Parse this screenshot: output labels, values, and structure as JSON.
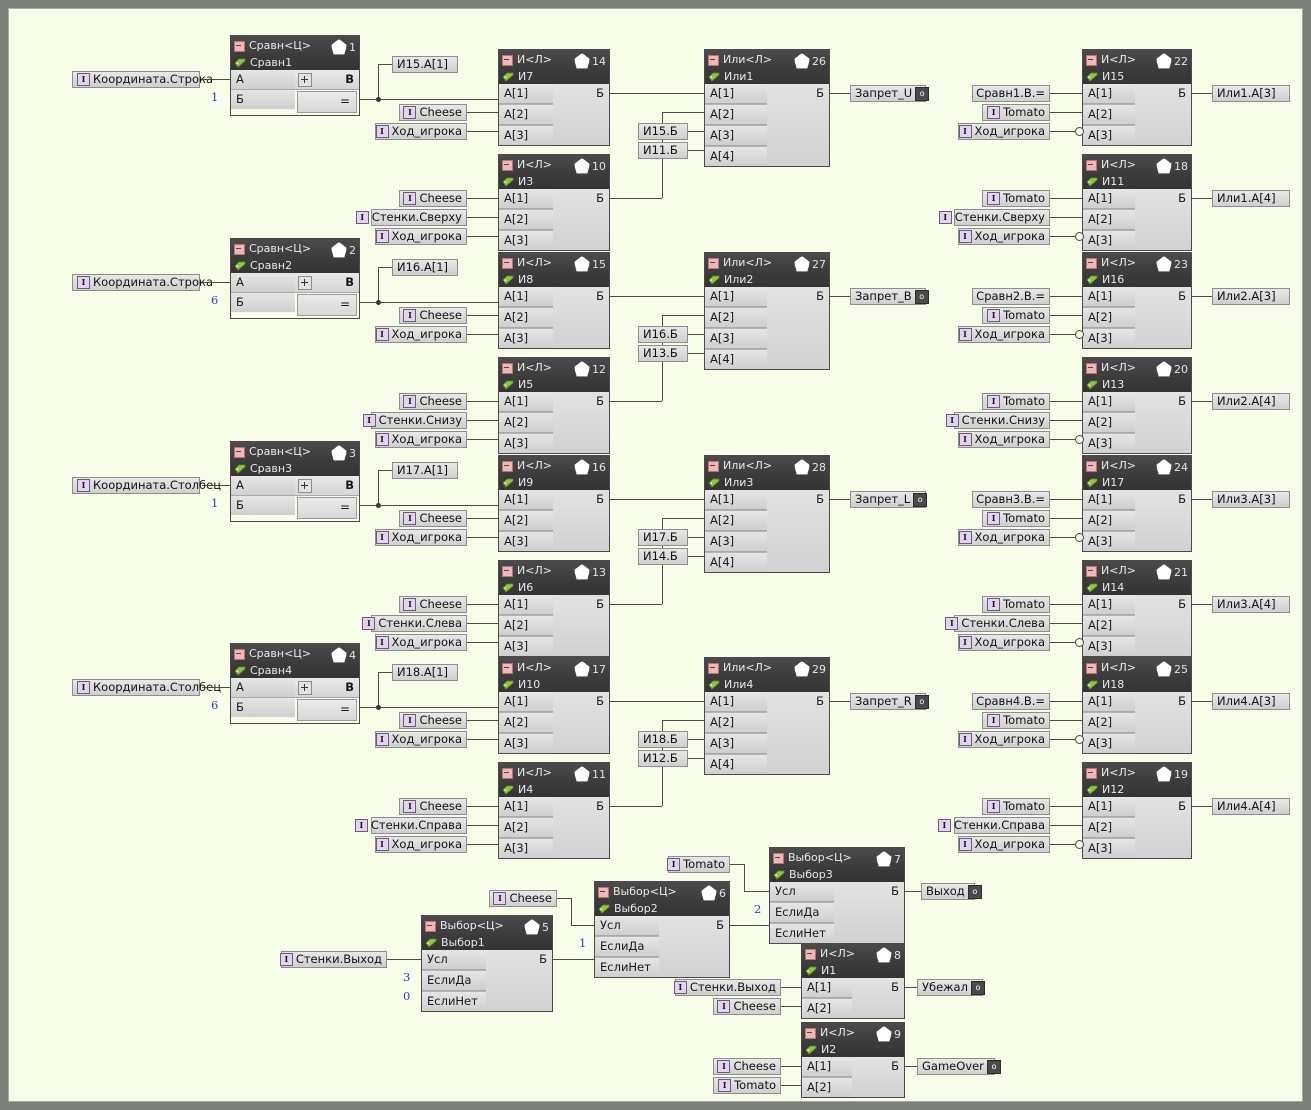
{
  "canvas": {
    "background": "#f8fde9",
    "frame_color": "#7d807a",
    "wire_color": "#4b4b4b"
  },
  "comparators": [
    {
      "id": "cmp1",
      "type": "Сравн<Ц>",
      "name": "Сравн1",
      "num": "1",
      "in_a": "А",
      "in_b": "Б",
      "out_top": "В",
      "op": "=",
      "const": "1",
      "source": "Координата.Строка"
    },
    {
      "id": "cmp2",
      "type": "Сравн<Ц>",
      "name": "Сравн2",
      "num": "2",
      "in_a": "А",
      "in_b": "Б",
      "out_top": "В",
      "op": "=",
      "const": "6",
      "source": "Координата.Строка"
    },
    {
      "id": "cmp3",
      "type": "Сравн<Ц>",
      "name": "Сравн3",
      "num": "3",
      "in_a": "А",
      "in_b": "Б",
      "out_top": "В",
      "op": "=",
      "const": "1",
      "source": "Координата.Столбец"
    },
    {
      "id": "cmp4",
      "type": "Сравн<Ц>",
      "name": "Сравн4",
      "num": "4",
      "in_a": "А",
      "in_b": "Б",
      "out_top": "В",
      "op": "=",
      "const": "6",
      "source": "Координата.Столбец"
    }
  ],
  "and_blocks": [
    {
      "id": "i7",
      "type": "И<Л>",
      "name": "И7",
      "num": "14",
      "pins": [
        "А[1]",
        "А[2]",
        "А[3]"
      ],
      "out": "Б",
      "inputs": [
        "",
        "Cheese",
        "Ход_игрока"
      ],
      "ref": "И15.А[1]"
    },
    {
      "id": "i3",
      "type": "И<Л>",
      "name": "И3",
      "num": "10",
      "pins": [
        "А[1]",
        "А[2]",
        "А[3]"
      ],
      "out": "Б",
      "inputs": [
        "Cheese",
        "Стенки.Сверху",
        "Ход_игрока"
      ]
    },
    {
      "id": "i8",
      "type": "И<Л>",
      "name": "И8",
      "num": "15",
      "pins": [
        "А[1]",
        "А[2]",
        "А[3]"
      ],
      "out": "Б",
      "inputs": [
        "",
        "Cheese",
        "Ход_игрока"
      ],
      "ref": "И16.А[1]"
    },
    {
      "id": "i5",
      "type": "И<Л>",
      "name": "И5",
      "num": "12",
      "pins": [
        "А[1]",
        "А[2]",
        "А[3]"
      ],
      "out": "Б",
      "inputs": [
        "Cheese",
        "Стенки.Снизу",
        "Ход_игрока"
      ]
    },
    {
      "id": "i9",
      "type": "И<Л>",
      "name": "И9",
      "num": "16",
      "pins": [
        "А[1]",
        "А[2]",
        "А[3]"
      ],
      "out": "Б",
      "inputs": [
        "",
        "Cheese",
        "Ход_игрока"
      ],
      "ref": "И17.А[1]"
    },
    {
      "id": "i6",
      "type": "И<Л>",
      "name": "И6",
      "num": "13",
      "pins": [
        "А[1]",
        "А[2]",
        "А[3]"
      ],
      "out": "Б",
      "inputs": [
        "Cheese",
        "Стенки.Слева",
        "Ход_игрока"
      ]
    },
    {
      "id": "i10",
      "type": "И<Л>",
      "name": "И10",
      "num": "17",
      "pins": [
        "А[1]",
        "А[2]",
        "А[3]"
      ],
      "out": "Б",
      "inputs": [
        "",
        "Cheese",
        "Ход_игрока"
      ],
      "ref": "И18.А[1]"
    },
    {
      "id": "i4",
      "type": "И<Л>",
      "name": "И4",
      "num": "11",
      "pins": [
        "А[1]",
        "А[2]",
        "А[3]"
      ],
      "out": "Б",
      "inputs": [
        "Cheese",
        "Стенки.Справа",
        "Ход_игрока"
      ]
    }
  ],
  "or_blocks": [
    {
      "id": "or1",
      "type": "Или<Л>",
      "name": "Или1",
      "num": "26",
      "pins": [
        "А[1]",
        "А[2]",
        "А[3]",
        "А[4]"
      ],
      "out": "Б",
      "refs": [
        "И15.Б",
        "И11.Б"
      ],
      "output_label": "Запрет_U"
    },
    {
      "id": "or2",
      "type": "Или<Л>",
      "name": "Или2",
      "num": "27",
      "pins": [
        "А[1]",
        "А[2]",
        "А[3]",
        "А[4]"
      ],
      "out": "Б",
      "refs": [
        "И16.Б",
        "И13.Б"
      ],
      "output_label": "Запрет_B"
    },
    {
      "id": "or3",
      "type": "Или<Л>",
      "name": "Или3",
      "num": "28",
      "pins": [
        "А[1]",
        "А[2]",
        "А[3]",
        "А[4]"
      ],
      "out": "Б",
      "refs": [
        "И17.Б",
        "И14.Б"
      ],
      "output_label": "Запрет_L"
    },
    {
      "id": "or4",
      "type": "Или<Л>",
      "name": "Или4",
      "num": "29",
      "pins": [
        "А[1]",
        "А[2]",
        "А[3]",
        "А[4]"
      ],
      "out": "Б",
      "refs": [
        "И18.Б",
        "И12.Б"
      ],
      "output_label": "Запрет_R"
    }
  ],
  "right_and_blocks": [
    {
      "id": "i15",
      "type": "И<Л>",
      "name": "И15",
      "num": "22",
      "pins": [
        "А[1]",
        "А[2]",
        "А[3]"
      ],
      "out": "Б",
      "inputs": [
        "Сравн1.В.=",
        "Tomato",
        "Ход_игрока"
      ],
      "out_ref": "Или1.А[3]"
    },
    {
      "id": "i11",
      "type": "И<Л>",
      "name": "И11",
      "num": "18",
      "pins": [
        "А[1]",
        "А[2]",
        "А[3]"
      ],
      "out": "Б",
      "inputs": [
        "Tomato",
        "Стенки.Сверху",
        "Ход_игрока"
      ],
      "out_ref": "Или1.А[4]"
    },
    {
      "id": "i16",
      "type": "И<Л>",
      "name": "И16",
      "num": "23",
      "pins": [
        "А[1]",
        "А[2]",
        "А[3]"
      ],
      "out": "Б",
      "inputs": [
        "Сравн2.В.=",
        "Tomato",
        "Ход_игрока"
      ],
      "out_ref": "Или2.А[3]"
    },
    {
      "id": "i13",
      "type": "И<Л>",
      "name": "И13",
      "num": "20",
      "pins": [
        "А[1]",
        "А[2]",
        "А[3]"
      ],
      "out": "Б",
      "inputs": [
        "Tomato",
        "Стенки.Снизу",
        "Ход_игрока"
      ],
      "out_ref": "Или2.А[4]"
    },
    {
      "id": "i17",
      "type": "И<Л>",
      "name": "И17",
      "num": "24",
      "pins": [
        "А[1]",
        "А[2]",
        "А[3]"
      ],
      "out": "Б",
      "inputs": [
        "Сравн3.В.=",
        "Tomato",
        "Ход_игрока"
      ],
      "out_ref": "Или3.А[3]"
    },
    {
      "id": "i14",
      "type": "И<Л>",
      "name": "И14",
      "num": "21",
      "pins": [
        "А[1]",
        "А[2]",
        "А[3]"
      ],
      "out": "Б",
      "inputs": [
        "Tomato",
        "Стенки.Слева",
        "Ход_игрока"
      ],
      "out_ref": "Или3.А[4]"
    },
    {
      "id": "i18",
      "type": "И<Л>",
      "name": "И18",
      "num": "25",
      "pins": [
        "А[1]",
        "А[2]",
        "А[3]"
      ],
      "out": "Б",
      "inputs": [
        "Сравн4.В.=",
        "Tomato",
        "Ход_игрока"
      ],
      "out_ref": "Или4.А[3]"
    },
    {
      "id": "i12",
      "type": "И<Л>",
      "name": "И12",
      "num": "19",
      "pins": [
        "А[1]",
        "А[2]",
        "А[3]"
      ],
      "out": "Б",
      "inputs": [
        "Tomato",
        "Стенки.Справа",
        "Ход_игрока"
      ],
      "out_ref": "Или4.А[4]"
    }
  ],
  "select_blocks": [
    {
      "id": "sel1",
      "type": "Выбор<Ц>",
      "name": "Выбор1",
      "num": "5",
      "pins": [
        "Усл",
        "ЕслиДа",
        "ЕслиНет"
      ],
      "out": "Б",
      "input": "Стенки.Выход",
      "const_yes": "3",
      "const_no": "0"
    },
    {
      "id": "sel2",
      "type": "Выбор<Ц>",
      "name": "Выбор2",
      "num": "6",
      "pins": [
        "Усл",
        "ЕслиДа",
        "ЕслиНет"
      ],
      "out": "Б",
      "input": "Cheese",
      "const_yes": "1"
    },
    {
      "id": "sel3",
      "type": "Выбор<Ц>",
      "name": "Выбор3",
      "num": "7",
      "pins": [
        "Усл",
        "ЕслиДа",
        "ЕслиНет"
      ],
      "out": "Б",
      "input": "Tomato",
      "const_yes": "2",
      "output_label": "Выход"
    }
  ],
  "bottom_and_blocks": [
    {
      "id": "i1",
      "type": "И<Л>",
      "name": "И1",
      "num": "8",
      "pins": [
        "А[1]",
        "А[2]"
      ],
      "out": "Б",
      "inputs": [
        "Стенки.Выход",
        "Cheese"
      ],
      "output_label": "Убежал"
    },
    {
      "id": "i2",
      "type": "И<Л>",
      "name": "И2",
      "num": "9",
      "pins": [
        "А[1]",
        "А[2]"
      ],
      "out": "Б",
      "inputs": [
        "Cheese",
        "Tomato"
      ],
      "output_label": "GameOver"
    }
  ],
  "icons": {
    "collapse": "minus-icon",
    "tag": "tag-icon",
    "pentagon": "pentagon-icon",
    "input_pin": "input-pin-icon",
    "output_pin": "output-pin-icon",
    "plus": "plus-icon"
  }
}
